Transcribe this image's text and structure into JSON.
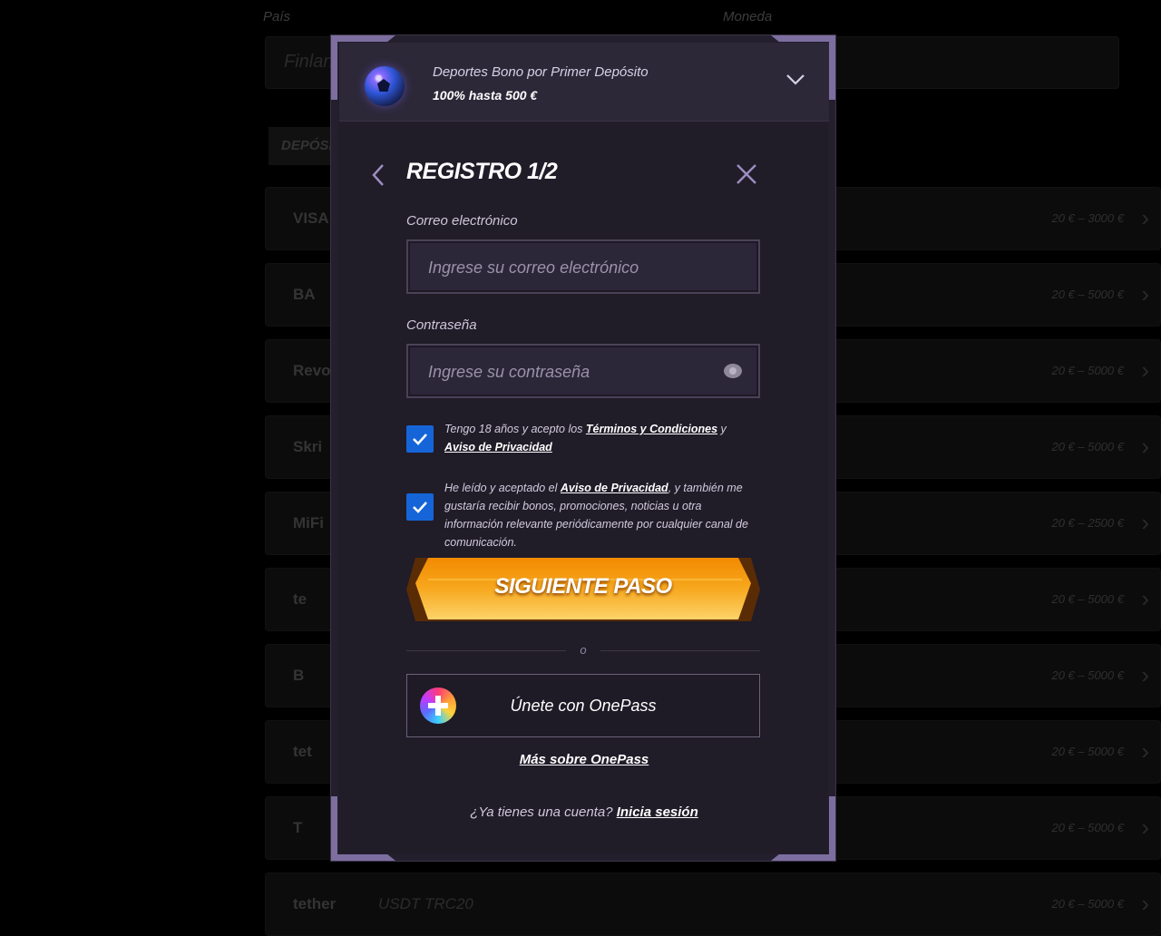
{
  "background": {
    "pais_label": "País",
    "moneda_label": "Moneda",
    "country_value": "Finland",
    "deposit_tab": "DEPÓSIT",
    "payment_methods": [
      {
        "logo": "VISA",
        "name": "",
        "range": "20 € – 3000 €"
      },
      {
        "logo": "BA",
        "name": "",
        "range": "20 € – 5000 €"
      },
      {
        "logo": "Revo",
        "name": "",
        "range": "20 € – 5000 €"
      },
      {
        "logo": "Skri",
        "name": "",
        "range": "20 € – 5000 €"
      },
      {
        "logo": "MiFi",
        "name": "",
        "range": "20 € – 2500 €"
      },
      {
        "logo": "te",
        "name": "",
        "range": "20 € – 5000 €"
      },
      {
        "logo": "B",
        "name": "",
        "range": "20 € – 5000 €"
      },
      {
        "logo": "tet",
        "name": "",
        "range": "20 € – 5000 €"
      },
      {
        "logo": "T",
        "name": "",
        "range": "20 € – 5000 €"
      },
      {
        "logo": "tether",
        "name": "USDT TRC20",
        "range": "20 € – 5000 €"
      }
    ]
  },
  "promo": {
    "title": "Deportes Bono por Primer Depósito",
    "subtitle": "100% hasta 500 €",
    "icon": "soccer-ball-icon"
  },
  "form": {
    "title": "REGISTRO 1/2",
    "email_label": "Correo electrónico",
    "email_placeholder": "Ingrese su correo electrónico",
    "email_value": "",
    "password_label": "Contraseña",
    "password_placeholder": "Ingrese su contraseña",
    "password_value": "",
    "terms_prefix": "Tengo 18 años y acepto los ",
    "terms_link": "Términos y Condiciones",
    "terms_mid": " y ",
    "privacy_link": "Aviso de Privacidad",
    "marketing_prefix": "He leído y aceptado el ",
    "marketing_link": "Aviso de Privacidad",
    "marketing_suffix": ", y también me gustaría recibir bonos, promociones, noticias u otra información relevante periódicamente por cualquier canal de comunicación.",
    "terms_checked": true,
    "marketing_checked": true,
    "submit_label": "SIGUIENTE PASO",
    "or_label": "o",
    "onepass_label": "Únete con OnePass",
    "onepass_more": "Más sobre OnePass",
    "login_prompt": "¿Ya tienes una cuenta? ",
    "login_link": "Inicia sesión"
  },
  "colors": {
    "accent_purple": "#7d6ea0",
    "checkbox_blue": "#1565d8",
    "cta_orange": "#f59a0c"
  }
}
